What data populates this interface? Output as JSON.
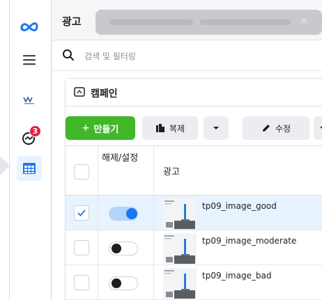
{
  "header": {
    "title": "광고"
  },
  "search": {
    "placeholder": "검색 및 필터링"
  },
  "campaign_tab": {
    "label": "캠페인"
  },
  "toolbar": {
    "create_label": "만들기",
    "duplicate_label": "복제",
    "edit_label": "수정"
  },
  "notifications": {
    "count": "3"
  },
  "table": {
    "columns": {
      "on_off": "해제/설정",
      "ad": "광고"
    },
    "rows": [
      {
        "name": "tp09_image_good",
        "checked": true,
        "on": true
      },
      {
        "name": "tp09_image_moderate",
        "checked": false,
        "on": false
      },
      {
        "name": "tp09_image_bad",
        "checked": false,
        "on": false
      }
    ]
  },
  "colors": {
    "accent": "#1877f2",
    "create": "#42b72a",
    "badge": "#e41e3f",
    "selected_row": "#e7f3ff"
  },
  "icons": [
    "meta-logo-icon",
    "menu-icon",
    "brand-logo-icon",
    "notification-icon",
    "table-grid-icon",
    "search-icon",
    "folder-icon",
    "duplicate-icon",
    "pencil-icon",
    "chevron-down-icon",
    "close-icon",
    "check-icon"
  ]
}
